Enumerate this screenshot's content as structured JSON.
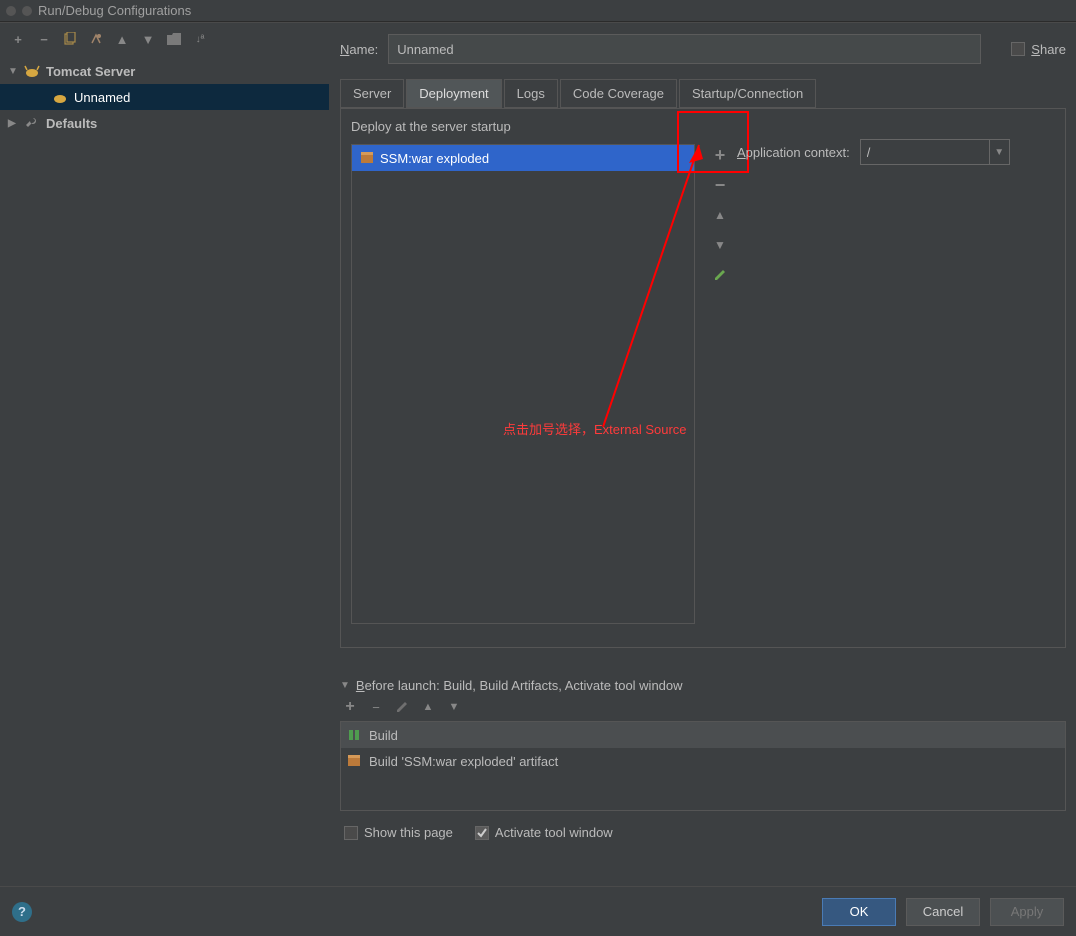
{
  "window": {
    "title": "Run/Debug Configurations"
  },
  "tree": {
    "tomcat_label": "Tomcat Server",
    "config_name": "Unnamed",
    "defaults_label": "Defaults"
  },
  "right": {
    "name_label": "Name:",
    "name_value": "Unnamed",
    "share_label": "Share"
  },
  "tabs": {
    "server": "Server",
    "deployment": "Deployment",
    "logs": "Logs",
    "coverage": "Code Coverage",
    "startup": "Startup/Connection"
  },
  "deploy": {
    "label": "Deploy at the server startup",
    "item": "SSM:war exploded",
    "app_ctx_label": "Application context:",
    "app_ctx_value": "/"
  },
  "annotation": {
    "chinese": "点击加号选择，",
    "english": "External Source"
  },
  "before_launch": {
    "label": "Before launch: Build, Build Artifacts, Activate tool window",
    "build": "Build",
    "artifact": "Build 'SSM:war exploded' artifact"
  },
  "checks": {
    "show": "Show this page",
    "activate": "Activate tool window"
  },
  "buttons": {
    "ok": "OK",
    "cancel": "Cancel",
    "apply": "Apply"
  }
}
